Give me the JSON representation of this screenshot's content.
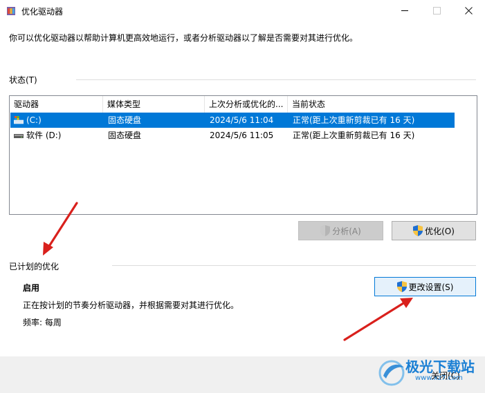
{
  "window": {
    "title": "优化驱动器",
    "description": "你可以优化驱动器以帮助计算机更高效地运行，或者分析驱动器以了解是否需要对其进行优化。"
  },
  "status_group": {
    "label": "状态(T)",
    "columns": [
      "驱动器",
      "媒体类型",
      "上次分析或优化的...",
      "当前状态"
    ],
    "rows": [
      {
        "drive": "(C:)",
        "media": "固态硬盘",
        "last": "2024/5/6 11:04",
        "status": "正常(距上次重新剪裁已有 16 天)",
        "selected": true
      },
      {
        "drive": "软件 (D:)",
        "media": "固态硬盘",
        "last": "2024/5/6 11:05",
        "status": "正常(距上次重新剪裁已有 16 天)",
        "selected": false
      }
    ]
  },
  "actions": {
    "analyze_label": "分析(A)",
    "optimize_label": "优化(O)"
  },
  "schedule_group": {
    "label": "已计划的优化",
    "status": "启用",
    "description": "正在按计划的节奏分析驱动器，并根据需要对其进行优化。",
    "frequency": "频率: 每周",
    "change_settings_label": "更改设置(S)"
  },
  "footer": {
    "close_label": "关闭(C)"
  },
  "watermark": {
    "name": "极光下载站",
    "url": "www.xz7.com"
  },
  "colors": {
    "selection": "#0078d7",
    "annotation_arrow": "#d9201c",
    "watermark": "#1a7fd4"
  }
}
